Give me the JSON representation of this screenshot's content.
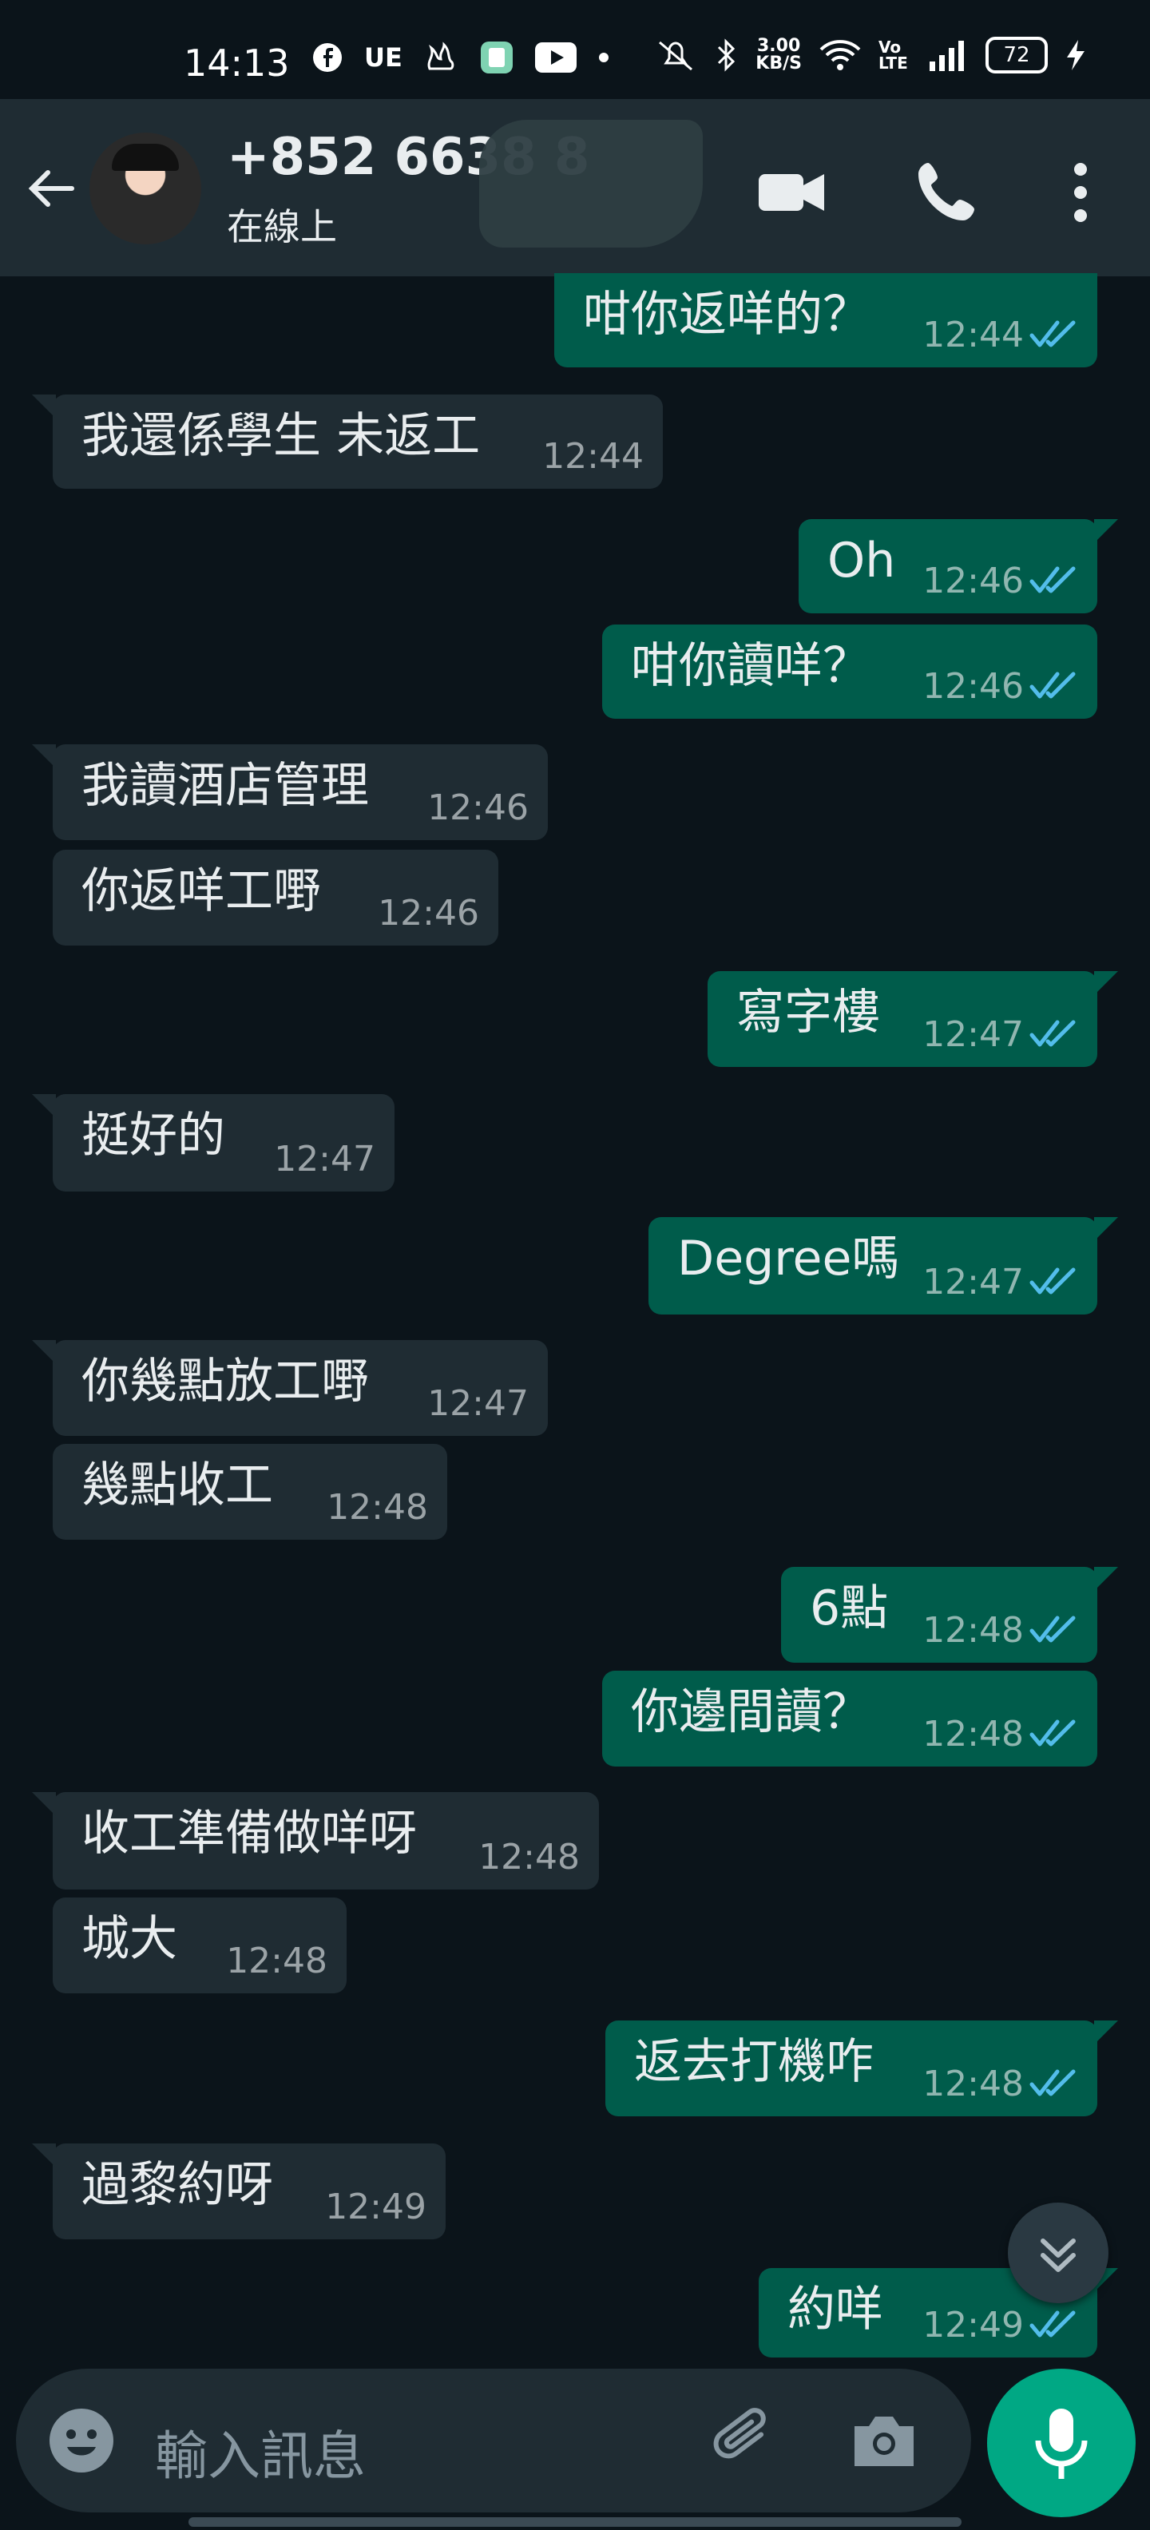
{
  "status_bar": {
    "time": "14:13",
    "net_speed_value": "3.00",
    "net_speed_unit": "KB/S",
    "volte": "Vo LTE",
    "battery": "72",
    "icons": [
      "facebook-icon",
      "ue-icon",
      "app-icon",
      "green-app-icon",
      "youtube-icon",
      "dot-icon",
      "mute-icon",
      "bluetooth-icon",
      "wifi-icon",
      "signal-icon",
      "charging-icon"
    ]
  },
  "header": {
    "contact_name": "+852 6638 8",
    "status": "在線上",
    "icons": [
      "back-arrow-icon",
      "video-call-icon",
      "phone-call-icon",
      "more-options-icon"
    ]
  },
  "messages": [
    {
      "dir": "out",
      "text": "咁你返咩的？",
      "time": "12:44",
      "read": true
    },
    {
      "dir": "in",
      "text": "我還係學生 未返工",
      "time": "12:44"
    },
    {
      "dir": "out",
      "text": "Oh",
      "time": "12:46",
      "read": true
    },
    {
      "dir": "out",
      "text": "咁你讀咩？",
      "time": "12:46",
      "read": true
    },
    {
      "dir": "in",
      "text": "我讀酒店管理",
      "time": "12:46"
    },
    {
      "dir": "in",
      "text": "你返咩工嘢",
      "time": "12:46"
    },
    {
      "dir": "out",
      "text": "寫字樓",
      "time": "12:47",
      "read": true
    },
    {
      "dir": "in",
      "text": "挺好的",
      "time": "12:47"
    },
    {
      "dir": "out",
      "text": "Degree嗎",
      "time": "12:47",
      "read": true
    },
    {
      "dir": "in",
      "text": "你幾點放工嘢",
      "time": "12:47"
    },
    {
      "dir": "in",
      "text": "幾點收工",
      "time": "12:48"
    },
    {
      "dir": "out",
      "text": "6點",
      "time": "12:48",
      "read": true
    },
    {
      "dir": "out",
      "text": "你邊間讀？",
      "time": "12:48",
      "read": true
    },
    {
      "dir": "in",
      "text": "收工準備做咩呀",
      "time": "12:48"
    },
    {
      "dir": "in",
      "text": "城大",
      "time": "12:48"
    },
    {
      "dir": "out",
      "text": "返去打機咋",
      "time": "12:48",
      "read": true
    },
    {
      "dir": "in",
      "text": "過黎約呀",
      "time": "12:49"
    },
    {
      "dir": "out",
      "text": "約咩",
      "time": "12:49",
      "read": true
    }
  ],
  "input": {
    "placeholder": "輸入訊息",
    "icons": [
      "emoji-icon",
      "attach-icon",
      "camera-icon",
      "microphone-icon",
      "scroll-down-icon"
    ]
  },
  "colors": {
    "background": "#0b141a",
    "header": "#1f2c33",
    "incoming_bubble": "#1f2c33",
    "outgoing_bubble": "#005c4b",
    "read_ticks": "#53bdeb",
    "accent": "#00a884"
  }
}
